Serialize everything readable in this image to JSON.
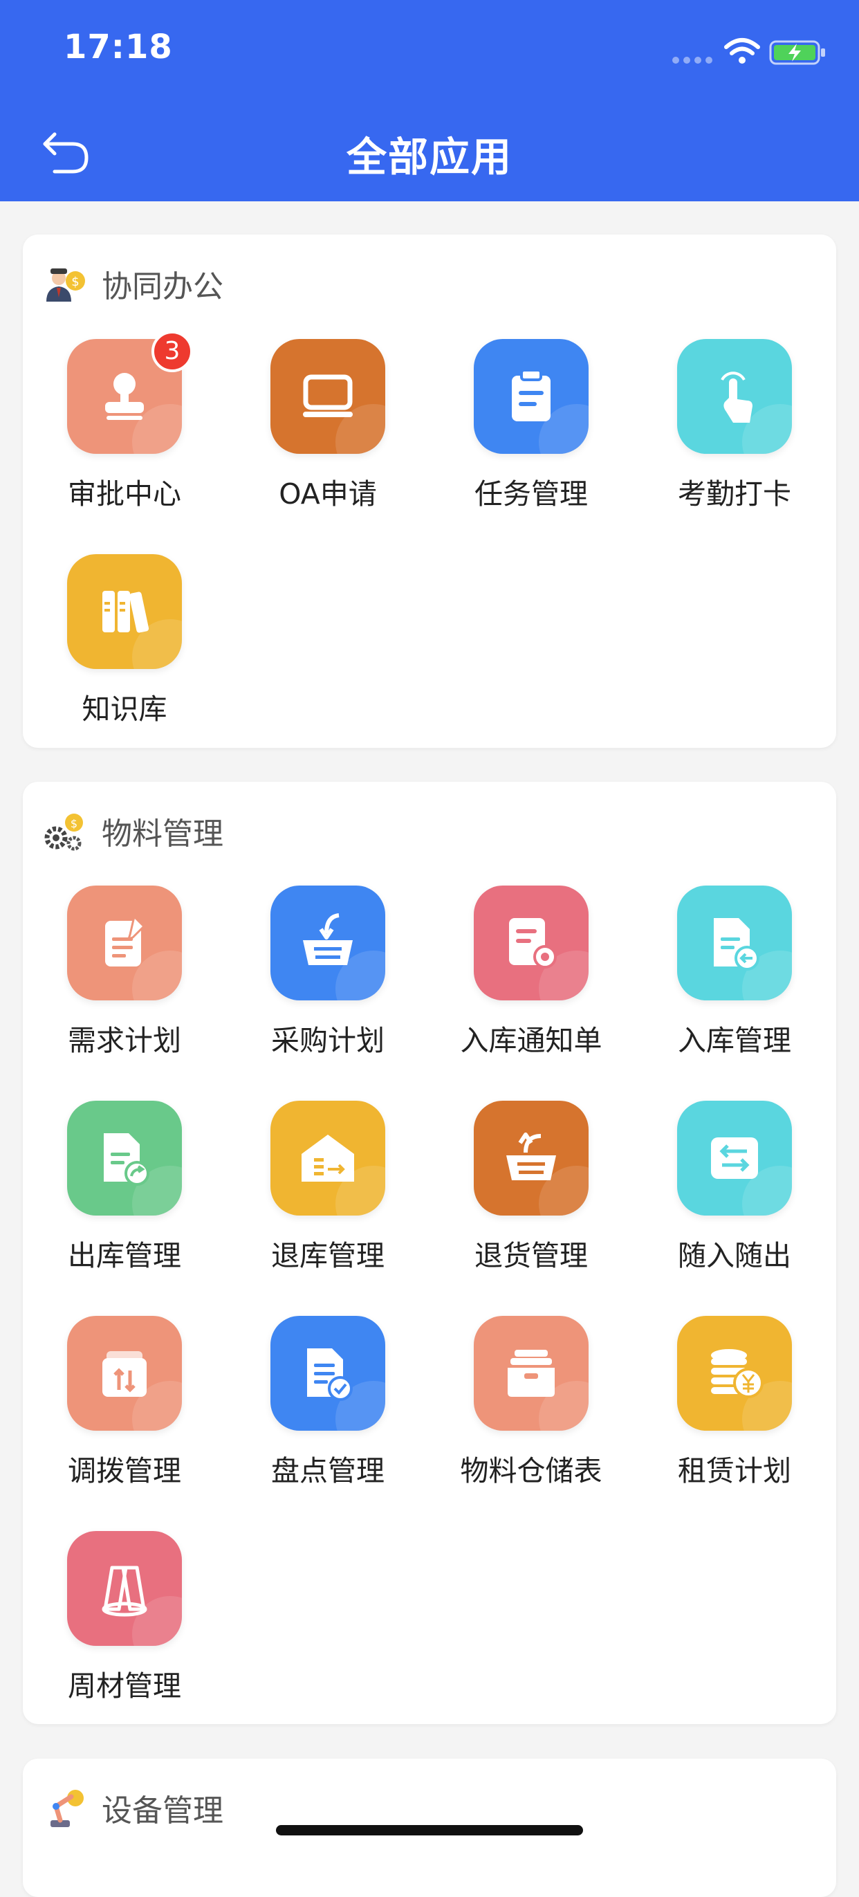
{
  "status_bar": {
    "time": "17:18"
  },
  "header": {
    "title": "全部应用"
  },
  "sections": [
    {
      "title": "协同办公",
      "apps": [
        {
          "label": "审批中心",
          "badge": "3"
        },
        {
          "label": "OA申请"
        },
        {
          "label": "任务管理"
        },
        {
          "label": "考勤打卡"
        },
        {
          "label": "知识库"
        }
      ]
    },
    {
      "title": "物料管理",
      "apps": [
        {
          "label": "需求计划"
        },
        {
          "label": "采购计划"
        },
        {
          "label": "入库通知单"
        },
        {
          "label": "入库管理"
        },
        {
          "label": "出库管理"
        },
        {
          "label": "退库管理"
        },
        {
          "label": "退货管理"
        },
        {
          "label": "随入随出"
        },
        {
          "label": "调拨管理"
        },
        {
          "label": "盘点管理"
        },
        {
          "label": "物料仓储表"
        },
        {
          "label": "租赁计划"
        },
        {
          "label": "周材管理"
        }
      ]
    },
    {
      "title": "设备管理",
      "apps": []
    }
  ],
  "colors": {
    "header": "#3768f0",
    "salmon": "#ee9479",
    "orange": "#d6742e",
    "blue": "#3f86f2",
    "cyan": "#5ad6df",
    "yellow": "#f0b531",
    "pink": "#e8707f",
    "green": "#69c98a",
    "badge": "#ee3a2f"
  }
}
